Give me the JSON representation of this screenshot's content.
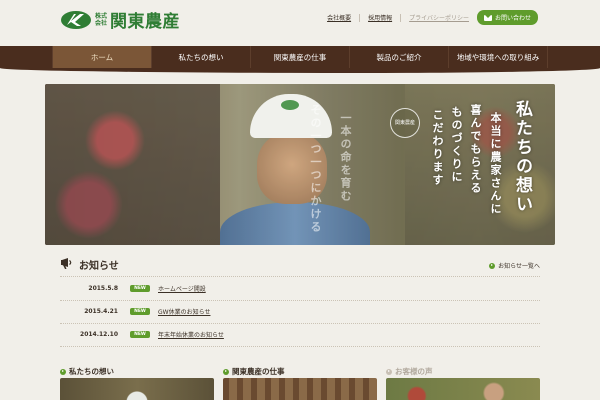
{
  "header": {
    "logo_kabu_1": "株式",
    "logo_kabu_2": "会社",
    "logo_name": "関東農産",
    "util_links": [
      "会社概要",
      "採用情報",
      "プライバシーポリシー"
    ],
    "contact_label": "お問い合わせ"
  },
  "nav": {
    "items": [
      {
        "label": "ホーム"
      },
      {
        "label": "私たちの想い"
      },
      {
        "label": "関東農産の仕事"
      },
      {
        "label": "製品のご紹介"
      },
      {
        "label": "地域や環境への取り組み"
      }
    ]
  },
  "hero": {
    "title": "私たちの想い",
    "copy": [
      "本当に農家さんに",
      "喜んでもらえる",
      "ものづくりに",
      "こだわります"
    ],
    "faint_1": "その一つ一つにかける",
    "faint_2": "一本の命を育む",
    "badge": "関東農産"
  },
  "news": {
    "title": "お知らせ",
    "all_link": "お知らせ一覧へ",
    "items": [
      {
        "date": "2015.5.8",
        "badge": "NEW",
        "text": "ホームページ開設"
      },
      {
        "date": "2015.4.21",
        "badge": "NEW",
        "text": "GW休業のお知らせ"
      },
      {
        "date": "2014.12.10",
        "badge": "NEW",
        "text": "年末年始休業のお知らせ"
      }
    ]
  },
  "cards": [
    {
      "label": "私たちの想い"
    },
    {
      "label": "関東農産の仕事"
    },
    {
      "label": "お客様の声"
    }
  ],
  "colors": {
    "brand_green": "#5f9c2c",
    "nav_brown": "#4a2d1e",
    "background": "#f1efe9"
  }
}
